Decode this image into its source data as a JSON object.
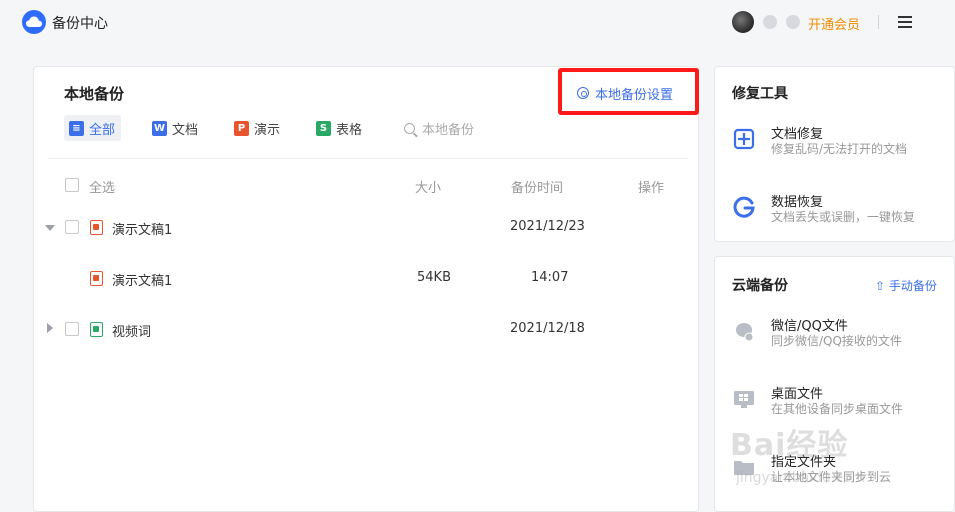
{
  "app": {
    "title": "备份中心"
  },
  "header": {
    "vip_label": "开通会员"
  },
  "local_backup": {
    "title": "本地备份",
    "settings_label": "本地备份设置",
    "filters": [
      {
        "label": "全部",
        "icon": "list-icon",
        "color": "#3a6fe8",
        "glyph": "≡",
        "active": true
      },
      {
        "label": "文档",
        "icon": "word-doc-icon",
        "color": "#3a6fe8",
        "glyph": "W"
      },
      {
        "label": "演示",
        "icon": "ppt-icon",
        "color": "#e8542d",
        "glyph": "P"
      },
      {
        "label": "表格",
        "icon": "sheet-icon",
        "color": "#2aa866",
        "glyph": "S"
      }
    ],
    "search_placeholder": "本地备份",
    "columns": {
      "select_all": "全选",
      "size": "大小",
      "time": "备份时间",
      "action": "操作"
    },
    "rows": [
      {
        "name": "演示文稿1",
        "size": "",
        "time": "2021/12/23",
        "type": "ppt",
        "expanded": true,
        "level": 0
      },
      {
        "name": "演示文稿1",
        "size": "54KB",
        "time": "14:07",
        "type": "ppt",
        "level": 1
      },
      {
        "name": "视频词",
        "size": "",
        "time": "2021/12/18",
        "type": "sheet",
        "expanded": false,
        "level": 0
      }
    ]
  },
  "repair_tools": {
    "title": "修复工具",
    "items": [
      {
        "name": "文档修复",
        "desc": "修复乱码/无法打开的文档",
        "icon": "doc-repair-icon"
      },
      {
        "name": "数据恢复",
        "desc": "文档丢失或误删，一键恢复",
        "icon": "data-recovery-icon"
      }
    ]
  },
  "cloud_backup": {
    "title": "云端备份",
    "manual_label": "手动备份",
    "items": [
      {
        "name": "微信/QQ文件",
        "desc": "同步微信/QQ接收的文件",
        "icon": "chat-file-icon"
      },
      {
        "name": "桌面文件",
        "desc": "在其他设备同步桌面文件",
        "icon": "desktop-icon"
      },
      {
        "name": "指定文件夹",
        "desc": "让本地文件夹同步到云",
        "icon": "folder-icon"
      }
    ]
  },
  "watermark": {
    "text": "Bai经验",
    "sub": "jingyan.baidu.com"
  }
}
